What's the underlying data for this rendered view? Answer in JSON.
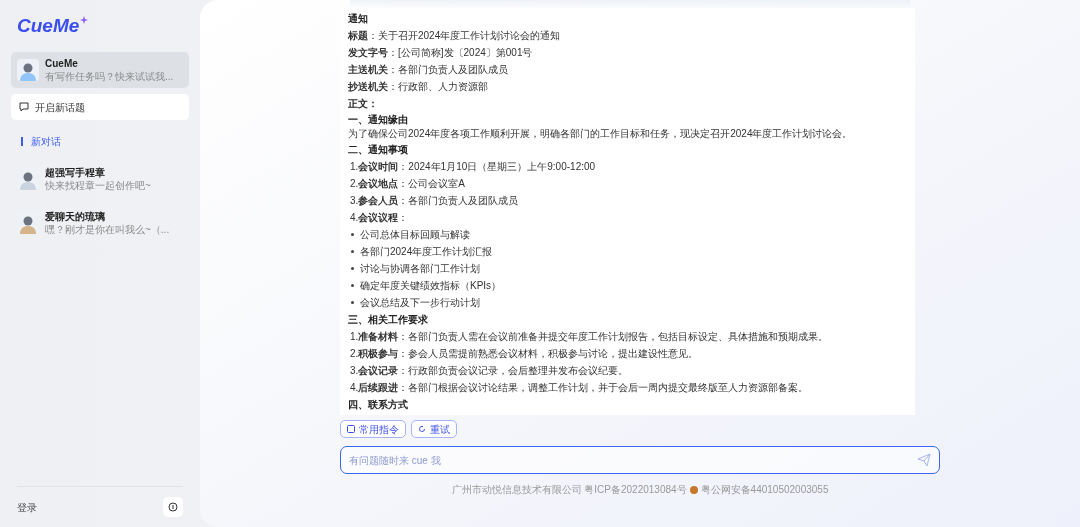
{
  "sidebar": {
    "logo": "CueMe",
    "chats": [
      {
        "name": "CueMe",
        "preview": "有写作任务吗？快来试试我...",
        "selected": true,
        "color": "#93c5fd"
      },
      {
        "name": "超强写手程章",
        "preview": "快来找程章一起创作吧~",
        "selected": false,
        "color": "#cbd5e1"
      },
      {
        "name": "爱聊天的琉璃",
        "preview": "嘿？刚才是你在叫我么~（...",
        "selected": false,
        "color": "#d6b38a"
      }
    ],
    "new_topic": "开启新话题",
    "section": "新对话",
    "login": "登录"
  },
  "document": [
    {
      "kind": "heading",
      "text": "通知"
    },
    {
      "kind": "field",
      "text": "**标题**：关于召开2024年度工作计划讨论会的通知"
    },
    {
      "kind": "field",
      "text": "**发文字号**：[公司简称]发〔2024〕第001号"
    },
    {
      "kind": "field",
      "text": "**主送机关**：各部门负责人及团队成员"
    },
    {
      "kind": "field",
      "text": "**抄送机关**：行政部、人力资源部"
    },
    {
      "kind": "heading",
      "text": "正文："
    },
    {
      "kind": "subheading",
      "text": "一、通知缘由"
    },
    {
      "kind": "paragraph",
      "text": "为了确保公司2024年度各项工作顺利开展，明确各部门的工作目标和任务，现决定召开2024年度工作计划讨论会。"
    },
    {
      "kind": "heading",
      "text": "二、通知事项"
    },
    {
      "kind": "numbered",
      "text": "1.**会议时间**：2024年1月10日（星期三）上午9:00-12:00"
    },
    {
      "kind": "numbered",
      "text": "2.**会议地点**：公司会议室A"
    },
    {
      "kind": "numbered",
      "text": "3.**参会人员**：各部门负责人及团队成员"
    },
    {
      "kind": "numbered",
      "text": "4.**会议议程**："
    },
    {
      "kind": "bullet",
      "text": "公司总体目标回顾与解读"
    },
    {
      "kind": "bullet",
      "text": "各部门2024年度工作计划汇报"
    },
    {
      "kind": "bullet",
      "text": "讨论与协调各部门工作计划"
    },
    {
      "kind": "bullet",
      "text": "确定年度关键绩效指标（KPIs）"
    },
    {
      "kind": "bullet",
      "text": "会议总结及下一步行动计划"
    },
    {
      "kind": "heading",
      "text": "三、相关工作要求"
    },
    {
      "kind": "numbered",
      "text": "1.**准备材料**：各部门负责人需在会议前准备并提交年度工作计划报告，包括目标设定、具体措施和预期成果。"
    },
    {
      "kind": "numbered",
      "text": "2.**积极参与**：参会人员需提前熟悉会议材料，积极参与讨论，提出建设性意见。"
    },
    {
      "kind": "numbered",
      "text": "3.**会议记录**：行政部负责会议记录，会后整理并发布会议纪要。"
    },
    {
      "kind": "numbered",
      "text": "4.**后续跟进**：各部门根据会议讨论结果，调整工作计划，并于会后一周内提交最终版至人力资源部备案。"
    },
    {
      "kind": "heading",
      "text": "四、联系方式"
    }
  ],
  "actions": [
    "常用指令",
    "重试"
  ],
  "input": {
    "placeholder": "有问题随时来 cue 我"
  },
  "footer": {
    "company": "广州市动悦信息技术有限公司 粤ICP备2022013084号",
    "police": "粤公网安备44010502003055"
  }
}
